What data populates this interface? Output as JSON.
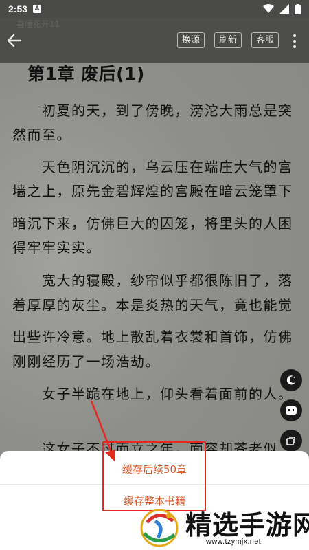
{
  "status_bar": {
    "time": "2:53",
    "notification_glyph": "A"
  },
  "toolbar": {
    "ghost_text": "春暖花开11",
    "buttons": [
      {
        "label": "换源"
      },
      {
        "label": "刷新"
      },
      {
        "label": "客服"
      }
    ]
  },
  "chapter": {
    "title": "第1章 废后(1)",
    "lines": [
      "　　初夏的天，到了傍晚，滂沱大雨总是突",
      "然而至。",
      "　　天色阴沉沉的，乌云压在端庄大气的宫",
      "墙之上，原先金碧辉煌的宫殿在暗云笼罩下",
      "暗沉下来，仿佛巨大的囚笼，将里头的人困",
      "得牢牢实实。",
      "　　宽大的寝殿，纱帘似乎都很陈旧了，落",
      "着厚厚的灰尘。本是炎热的天气，竟也能觉",
      "出些许冷意。地上散乱着衣裳和首饰，仿佛",
      "刚刚经历了一场浩劫。",
      "　　女子半跪在地上，仰头看着面前的人。",
      "　　这女子不过而立之年，面容却苍老似"
    ]
  },
  "fabs": [
    "moon-icon",
    "robot-icon",
    "copy-icon"
  ],
  "cache_sheet": {
    "option_next50": "缓存后续50章",
    "option_full": "缓存整本书籍"
  },
  "watermark": {
    "text": "精选手游网",
    "url": "www.tzymjx.net"
  },
  "colors": {
    "accent_text": "#d95a2a",
    "highlight": "#e42a1e"
  }
}
